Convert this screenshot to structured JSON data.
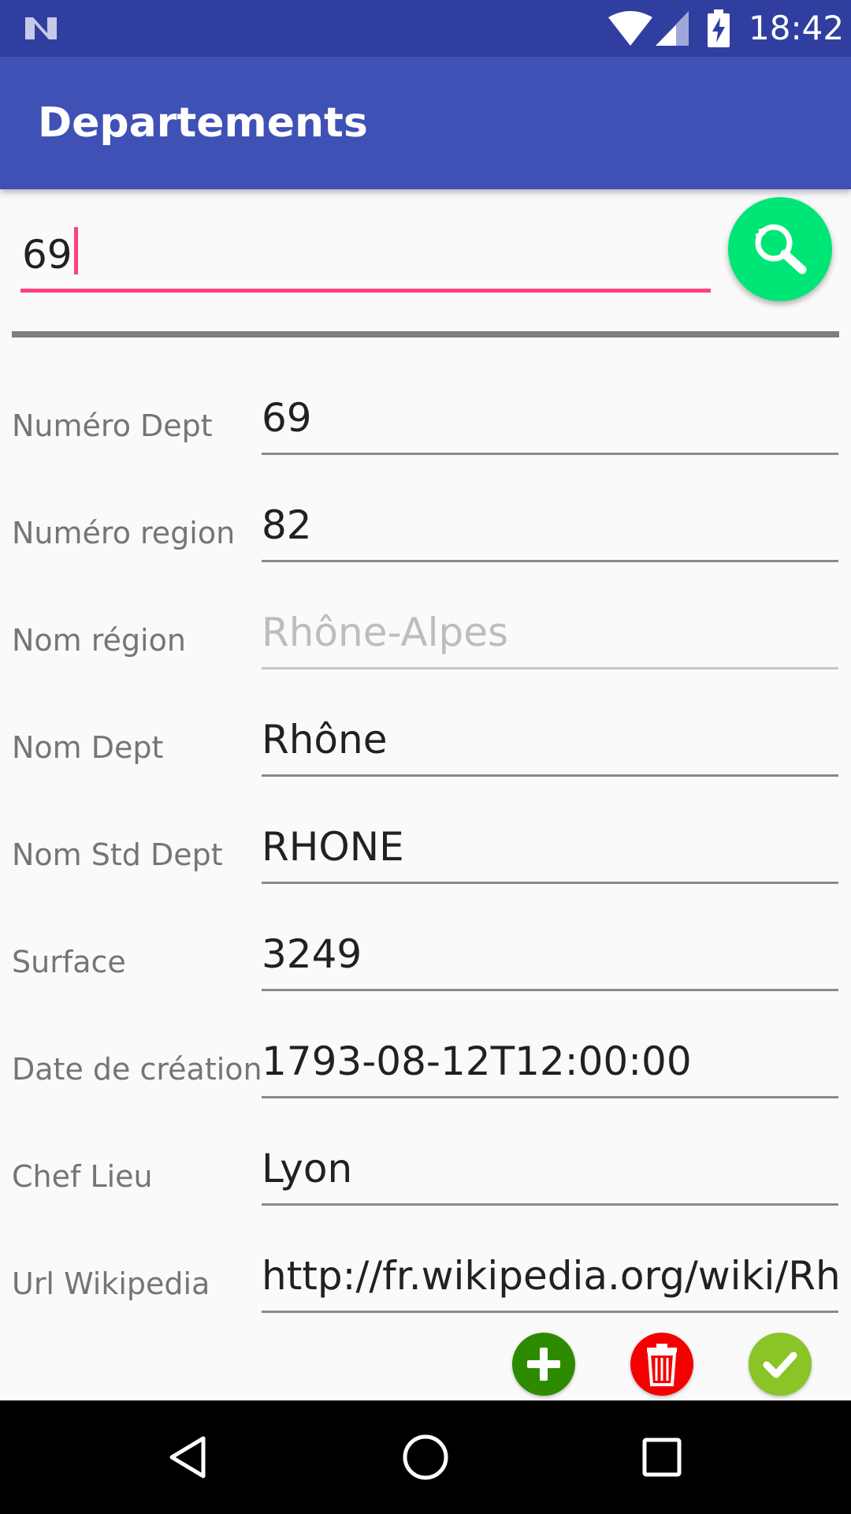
{
  "status_bar": {
    "time": "18:42",
    "icons": [
      "notification-n-icon",
      "wifi-icon",
      "signal-icon",
      "battery-charging-icon"
    ]
  },
  "app_bar": {
    "title": "Departements"
  },
  "search": {
    "value": "69",
    "button_icon": "search-icon",
    "accent_color": "#ff4081",
    "button_color": "#00e676"
  },
  "form": {
    "fields": [
      {
        "label": "Numéro Dept",
        "value": "69",
        "enabled": true
      },
      {
        "label": "Numéro region",
        "value": "82",
        "enabled": true
      },
      {
        "label": "Nom région",
        "value": "Rhône-Alpes",
        "enabled": false
      },
      {
        "label": "Nom Dept",
        "value": "Rhône",
        "enabled": true
      },
      {
        "label": "Nom Std Dept",
        "value": "RHONE",
        "enabled": true
      },
      {
        "label": "Surface",
        "value": "3249",
        "enabled": true
      },
      {
        "label": "Date de création",
        "value": "1793-08-12T12:00:00",
        "enabled": true
      },
      {
        "label": "Chef Lieu",
        "value": "Lyon",
        "enabled": true
      },
      {
        "label": "Url Wikipedia",
        "value": "http://fr.wikipedia.org/wiki/Rh%",
        "enabled": true
      }
    ]
  },
  "actions": {
    "add_icon": "plus-icon",
    "delete_icon": "trash-icon",
    "confirm_icon": "check-icon",
    "colors": {
      "add": "#2e8b00",
      "delete": "#f40000",
      "confirm": "#8bc426"
    }
  },
  "nav_bar": {
    "icons": [
      "back-icon",
      "home-icon",
      "recents-icon"
    ]
  },
  "colors": {
    "primary": "#3f51b5",
    "primary_dark": "#303f9f"
  }
}
